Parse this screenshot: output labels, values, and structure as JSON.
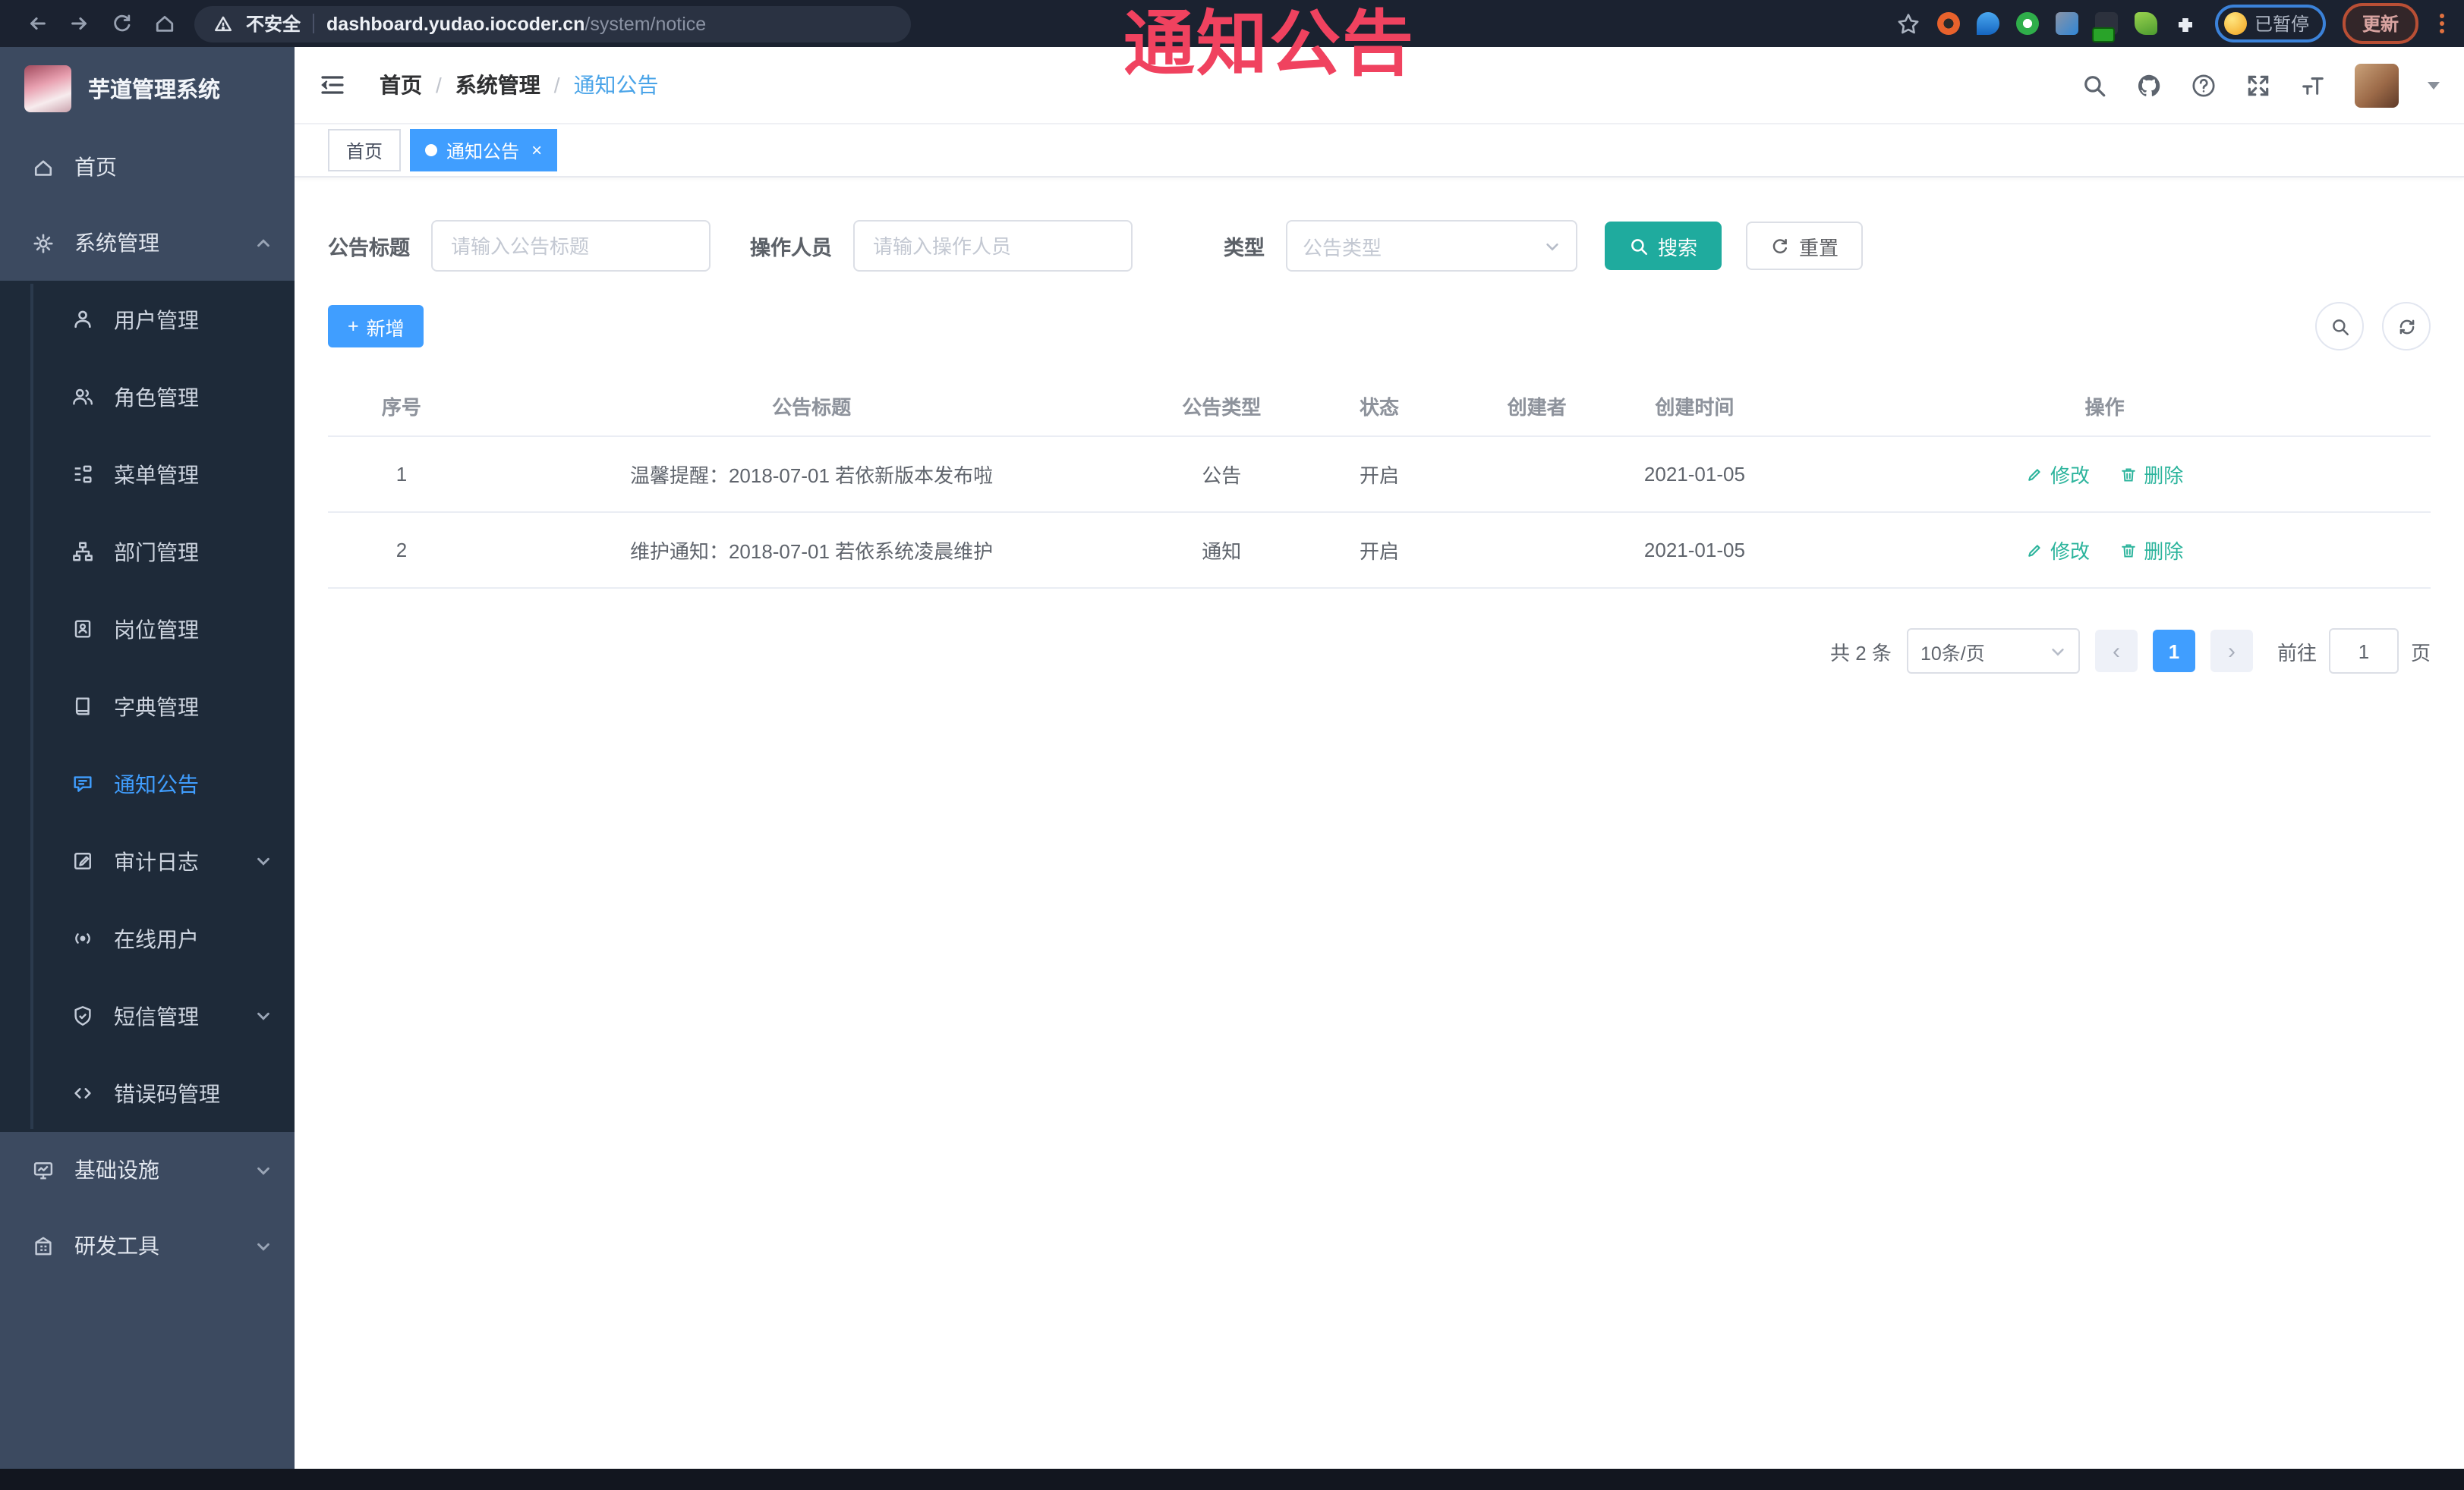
{
  "colors": {
    "accent": "#409EFF",
    "search_teal": "#1fab9e",
    "op_link_teal": "#2cb49c",
    "watermark_red": "#f0425f",
    "sidebar_bg": "#3c4a60",
    "submenu_bg": "#1e2a39"
  },
  "watermark": "通知公告",
  "browser": {
    "security_label": "不安全",
    "url_domain": "dashboard.yudao.iocoder.cn",
    "url_path": "/system/notice",
    "paused_label": "已暂停",
    "update_label": "更新"
  },
  "sidebar": {
    "title": "芋道管理系统",
    "items": [
      {
        "label": "首页"
      },
      {
        "label": "系统管理"
      },
      {
        "label": "用户管理"
      },
      {
        "label": "角色管理"
      },
      {
        "label": "菜单管理"
      },
      {
        "label": "部门管理"
      },
      {
        "label": "岗位管理"
      },
      {
        "label": "字典管理"
      },
      {
        "label": "通知公告"
      },
      {
        "label": "审计日志"
      },
      {
        "label": "在线用户"
      },
      {
        "label": "短信管理"
      },
      {
        "label": "错误码管理"
      },
      {
        "label": "基础设施"
      },
      {
        "label": "研发工具"
      }
    ]
  },
  "breadcrumb": {
    "items": [
      "首页",
      "系统管理",
      "通知公告"
    ],
    "separator": "/"
  },
  "tabs": [
    {
      "label": "首页"
    },
    {
      "label": "通知公告",
      "close": "×"
    }
  ],
  "filters": {
    "title_label": "公告标题",
    "title_placeholder": "请输入公告标题",
    "operator_label": "操作人员",
    "operator_placeholder": "请输入操作人员",
    "type_label": "类型",
    "type_placeholder": "公告类型"
  },
  "toolbar": {
    "search_label": "搜索",
    "reset_label": "重置",
    "add_label": "新增",
    "add_plus": "+"
  },
  "table": {
    "columns": [
      "序号",
      "公告标题",
      "公告类型",
      "状态",
      "创建者",
      "创建时间",
      "操作"
    ],
    "rows": [
      {
        "no": "1",
        "title": "温馨提醒：2018-07-01 若依新版本发布啦",
        "type": "公告",
        "status": "开启",
        "creator": "",
        "time": "2021-01-05"
      },
      {
        "no": "2",
        "title": "维护通知：2018-07-01 若依系统凌晨维护",
        "type": "通知",
        "status": "开启",
        "creator": "",
        "time": "2021-01-05"
      }
    ],
    "op_edit": "修改",
    "op_delete": "删除"
  },
  "pagination": {
    "total": "共 2 条",
    "page_size": "10条/页",
    "prev": "‹",
    "page": "1",
    "next": "›",
    "goto_prefix": "前往",
    "goto_value": "1",
    "goto_suffix": "页"
  }
}
